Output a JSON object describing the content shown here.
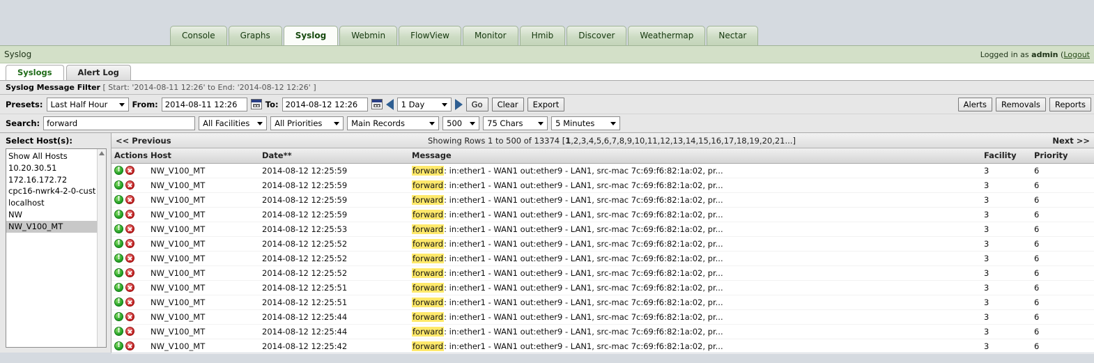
{
  "window": {
    "background": "#d5dae0"
  },
  "main_tabs": [
    {
      "label": "Console",
      "active": false
    },
    {
      "label": "Graphs",
      "active": false
    },
    {
      "label": "Syslog",
      "active": true
    },
    {
      "label": "Webmin",
      "active": false
    },
    {
      "label": "FlowView",
      "active": false
    },
    {
      "label": "Monitor",
      "active": false
    },
    {
      "label": "Hmib",
      "active": false
    },
    {
      "label": "Discover",
      "active": false
    },
    {
      "label": "Weathermap",
      "active": false
    },
    {
      "label": "Nectar",
      "active": false
    }
  ],
  "header": {
    "page_title": "Syslog",
    "login_prefix": "Logged in as ",
    "login_user": "admin",
    "login_paren_open": " (",
    "logout_label": "Logout"
  },
  "sub_tabs": [
    {
      "label": "Syslogs",
      "active": true
    },
    {
      "label": "Alert Log",
      "active": false
    }
  ],
  "filter": {
    "title": "Syslog Message Filter",
    "range_text": "[ Start: '2014-08-11 12:26' to End: '2014-08-12 12:26' ]",
    "presets_label": "Presets:",
    "presets_value": "Last Half Hour",
    "from_label": "From:",
    "from_value": "2014-08-11 12:26",
    "to_label": "To:",
    "to_value": "2014-08-12 12:26",
    "interval_value": "1 Day",
    "go_label": "Go",
    "clear_label": "Clear",
    "export_label": "Export",
    "alerts_label": "Alerts",
    "removals_label": "Removals",
    "reports_label": "Reports",
    "search_label": "Search:",
    "search_value": "forward",
    "search_placeholder": "",
    "facilities_value": "All Facilities",
    "priorities_value": "All Priorities",
    "records_value": "Main Records",
    "rows_value": "500",
    "chars_value": "75 Chars",
    "refresh_value": "5 Minutes"
  },
  "sidebar": {
    "title": "Select Host(s):",
    "hosts": [
      {
        "label": "Show All Hosts",
        "selected": false
      },
      {
        "label": "10.20.30.51",
        "selected": false
      },
      {
        "label": "172.16.172.72",
        "selected": false
      },
      {
        "label": "cpc16-nwrk4-2-0-cust",
        "selected": false
      },
      {
        "label": "localhost",
        "selected": false
      },
      {
        "label": "NW",
        "selected": false
      },
      {
        "label": "NW_V100_MT",
        "selected": true
      }
    ]
  },
  "pager": {
    "previous_label": "<< Previous",
    "showing_prefix": "Showing Rows 1 to 500 of 13374 [",
    "current_page": "1",
    "page_list": ",2,3,4,5,6,7,8,9,10,11,12,13,14,15,16,17,18,19,20,21...]",
    "next_label": "Next >>"
  },
  "table": {
    "columns": [
      "Actions",
      "Host",
      "Date**",
      "Message",
      "Facility",
      "Priority"
    ],
    "message_highlight": "forward",
    "message_rest": ": in:ether1 - WAN1 out:ether9 - LAN1, src-mac 7c:69:f6:82:1a:02, pr...",
    "rows": [
      {
        "host": "NW_V100_MT",
        "date": "2014-08-12 12:25:59",
        "facility": "3",
        "priority": "6"
      },
      {
        "host": "NW_V100_MT",
        "date": "2014-08-12 12:25:59",
        "facility": "3",
        "priority": "6"
      },
      {
        "host": "NW_V100_MT",
        "date": "2014-08-12 12:25:59",
        "facility": "3",
        "priority": "6"
      },
      {
        "host": "NW_V100_MT",
        "date": "2014-08-12 12:25:59",
        "facility": "3",
        "priority": "6"
      },
      {
        "host": "NW_V100_MT",
        "date": "2014-08-12 12:25:53",
        "facility": "3",
        "priority": "6"
      },
      {
        "host": "NW_V100_MT",
        "date": "2014-08-12 12:25:52",
        "facility": "3",
        "priority": "6"
      },
      {
        "host": "NW_V100_MT",
        "date": "2014-08-12 12:25:52",
        "facility": "3",
        "priority": "6"
      },
      {
        "host": "NW_V100_MT",
        "date": "2014-08-12 12:25:52",
        "facility": "3",
        "priority": "6"
      },
      {
        "host": "NW_V100_MT",
        "date": "2014-08-12 12:25:51",
        "facility": "3",
        "priority": "6"
      },
      {
        "host": "NW_V100_MT",
        "date": "2014-08-12 12:25:51",
        "facility": "3",
        "priority": "6"
      },
      {
        "host": "NW_V100_MT",
        "date": "2014-08-12 12:25:44",
        "facility": "3",
        "priority": "6"
      },
      {
        "host": "NW_V100_MT",
        "date": "2014-08-12 12:25:44",
        "facility": "3",
        "priority": "6"
      },
      {
        "host": "NW_V100_MT",
        "date": "2014-08-12 12:25:42",
        "facility": "3",
        "priority": "6"
      }
    ]
  }
}
